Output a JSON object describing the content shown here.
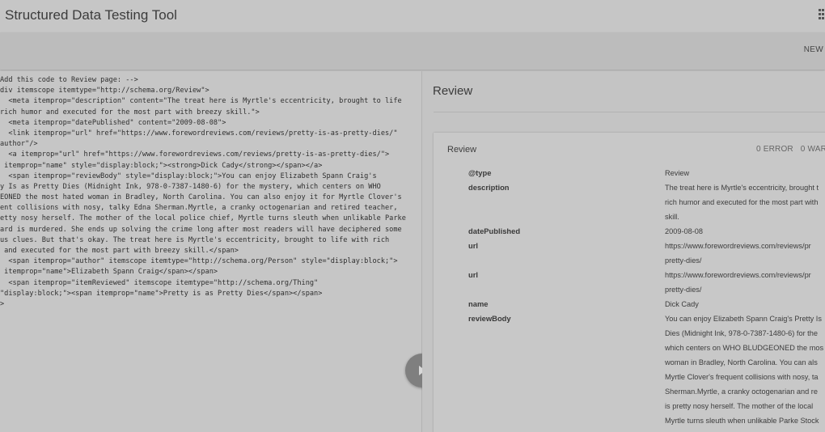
{
  "header": {
    "title": "Structured Data Testing Tool",
    "new_button": "NEW"
  },
  "code_input": {
    "lines": [
      "Add this code to Review page: -->",
      "div itemscope itemtype=\"http://schema.org/Review\">",
      "  <meta itemprop=\"description\" content=\"The treat here is Myrtle's eccentricity, brought to life",
      "rich humor and executed for the most part with breezy skill.\">",
      "  <meta itemprop=\"datePublished\" content=\"2009-08-08\">",
      "  <link itemprop=\"url\" href=\"https://www.forewordreviews.com/reviews/pretty-is-as-pretty-dies/\"",
      "author\"/>",
      "  <a itemprop=\"url\" href=\"https://www.forewordreviews.com/reviews/pretty-is-as-pretty-dies/\">",
      " itemprop=\"name\" style=\"display:block;\"><strong>Dick Cady</strong></span></a>",
      "  <span itemprop=\"reviewBody\" style=\"display:block;\">You can enjoy Elizabeth Spann Craig's",
      "y Is as Pretty Dies (Midnight Ink, 978-0-7387-1480-6) for the mystery, which centers on WHO",
      "EONED the most hated woman in Bradley, North Carolina. You can also enjoy it for Myrtle Clover's",
      "ent collisions with nosy, talky Edna Sherman.Myrtle, a cranky octogenarian and retired teacher,",
      "etty nosy herself. The mother of the local police chief, Myrtle turns sleuth when unlikable Parke",
      "ard is murdered. She ends up solving the crime long after most readers will have deciphered some",
      "us clues. But that's okay. The treat here is Myrtle's eccentricity, brought to life with rich",
      " and executed for the most part with breezy skill.</span>",
      "  <span itemprop=\"author\" itemscope itemtype=\"http://schema.org/Person\" style=\"display:block;\">",
      " itemprop=\"name\">Elizabeth Spann Craig</span></span>",
      "  <span itemprop=\"itemReviewed\" itemscope itemtype=\"http://schema.org/Thing\"",
      "\"display:block;\"><span itemprop=\"name\">Pretty is as Pretty Dies</span></span>",
      ">"
    ]
  },
  "results": {
    "header": "Review",
    "card": {
      "title": "Review",
      "errors": "0 ERROR",
      "warnings": "0 WAR",
      "properties": [
        {
          "name": "@type",
          "values": [
            "Review"
          ]
        },
        {
          "name": "description",
          "values": [
            "The treat here is Myrtle's eccentricity, brought t",
            "rich humor and executed for the most part with",
            "skill."
          ]
        },
        {
          "name": "datePublished",
          "values": [
            "2009-08-08"
          ]
        },
        {
          "name": "url",
          "values": [
            "https://www.forewordreviews.com/reviews/pr",
            "pretty-dies/"
          ]
        },
        {
          "name": "url",
          "values": [
            "https://www.forewordreviews.com/reviews/pr",
            "pretty-dies/"
          ]
        },
        {
          "name": "name",
          "values": [
            "Dick Cady"
          ]
        },
        {
          "name": "reviewBody",
          "values": [
            "You can enjoy Elizabeth Spann Craig's Pretty Is",
            "Dies (Midnight Ink, 978-0-7387-1480-6) for the",
            "which centers on WHO BLUDGEONED the mos",
            "woman in Bradley, North Carolina. You can als",
            "Myrtle Clover's frequent collisions with nosy, ta",
            "Sherman.Myrtle, a cranky octogenarian and re",
            "is pretty nosy herself. The mother of the local",
            "Myrtle turns sleuth when unlikable Parke Stock"
          ]
        }
      ]
    }
  },
  "icons": {
    "apps": "apps-grid-icon",
    "play": "play-icon"
  },
  "colors": {
    "overlay_background": "#c4c4c4",
    "play_button": "#7f7f7f"
  }
}
